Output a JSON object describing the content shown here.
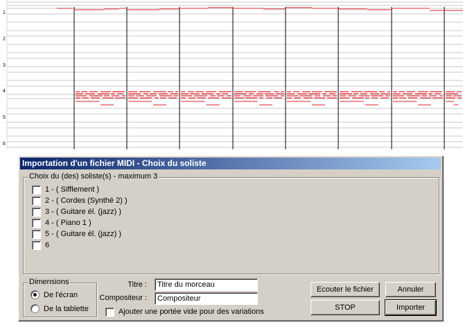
{
  "colors": {
    "note": "#e0202a",
    "staff_line": "#c8c8c8",
    "bar_line": "#000000",
    "title_bar": "#0a246a"
  },
  "piano_roll": {
    "row_labels": [
      "1",
      "2",
      "3",
      "4",
      "5",
      "6"
    ]
  },
  "dialog": {
    "title": "Importation d'un fichier MIDI - Choix du soliste",
    "soloist_group": {
      "label": "Choix du (des) soliste(s) - maximum 3",
      "items": [
        {
          "label": "1 - ( Sifflement )",
          "checked": false
        },
        {
          "label": "2 - ( Cordes (Synthé 2) )",
          "checked": false
        },
        {
          "label": "3 - ( Guitare él. (jazz) )",
          "checked": false
        },
        {
          "label": "4 - ( Piano 1 )",
          "checked": false
        },
        {
          "label": "5 - ( Guitare él. (jazz) )",
          "checked": false
        },
        {
          "label": "6",
          "checked": false
        }
      ]
    },
    "dimensions_group": {
      "label": "Dimensions",
      "options": [
        {
          "label": "De l'écran",
          "selected": true
        },
        {
          "label": "De la tablette",
          "selected": false
        }
      ]
    },
    "titre_label": "Titre :",
    "titre_value": "Titre du morceau",
    "compositeur_label": "Compositeur :",
    "compositeur_value": "Compositeur",
    "empty_staff_label": "Ajouter une portée vide pour des variations",
    "buttons": {
      "listen": "Ecouter le fichier",
      "cancel": "Annuler",
      "stop": "STOP",
      "import": "Importer"
    }
  }
}
